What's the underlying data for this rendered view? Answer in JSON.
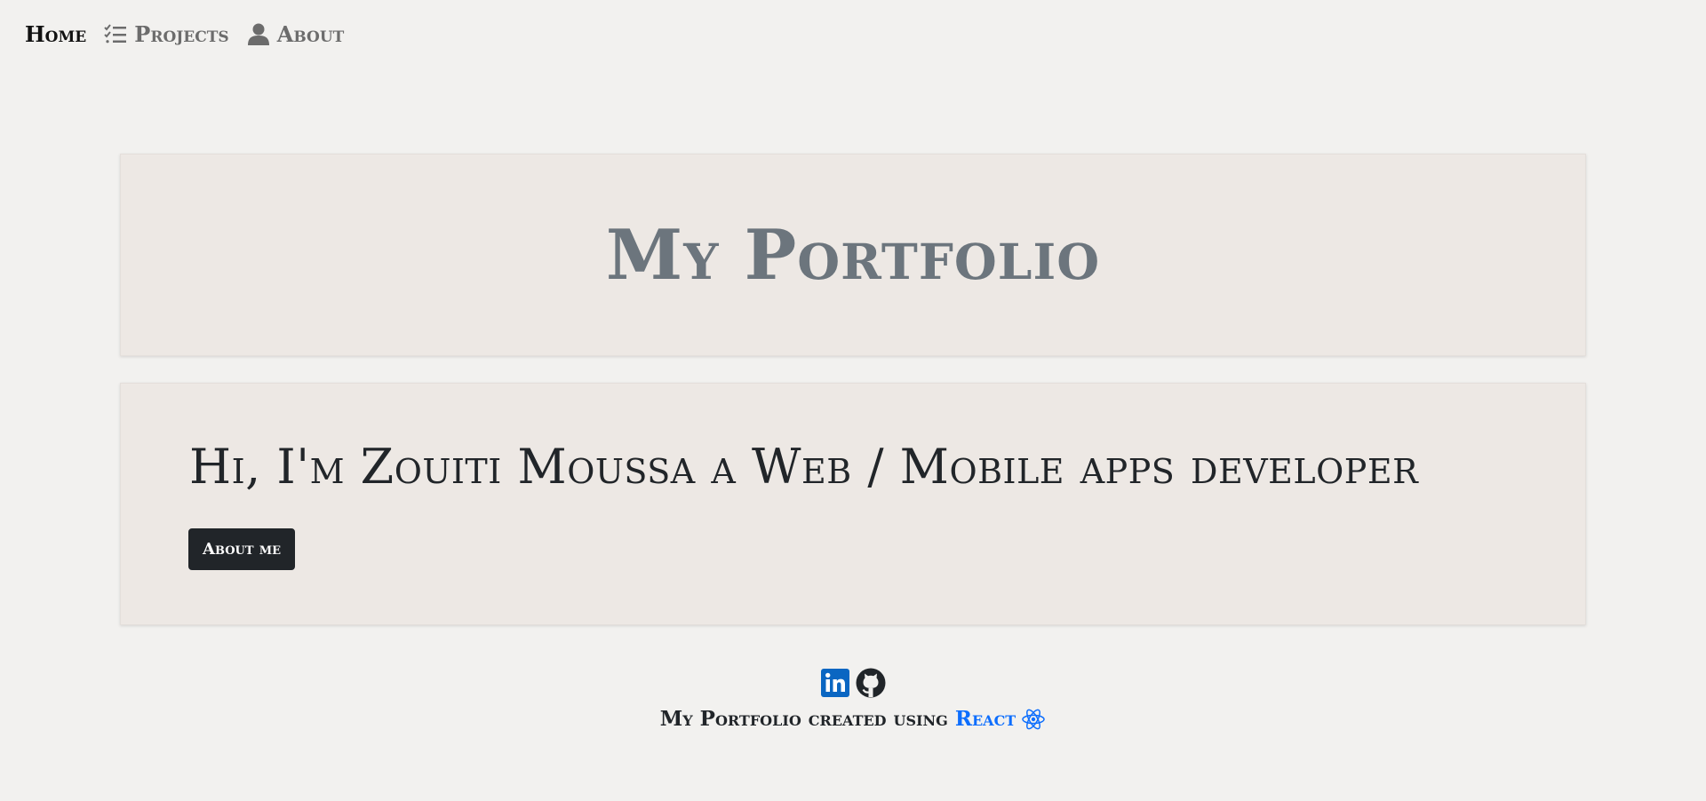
{
  "nav": {
    "home_label": "Home",
    "projects_label": "Projects",
    "about_label": "About"
  },
  "hero": {
    "title": "My Portfolio"
  },
  "intro": {
    "heading": "Hi, I'm Zouiti Moussa a Web / Mobile apps developer",
    "button_label": "About me"
  },
  "footer": {
    "text": "My Portfolio created using",
    "link_label": "React"
  },
  "icons": {
    "projects": "checklist-icon",
    "about": "user-icon",
    "linkedin": "linkedin-icon",
    "github": "github-icon",
    "react": "react-icon"
  },
  "colors": {
    "background": "#f2f1ef",
    "card": "#ede8e4",
    "hero_title": "#6c757d",
    "button": "#212529",
    "link": "#0d6efd",
    "linkedin": "#0a66c2"
  }
}
